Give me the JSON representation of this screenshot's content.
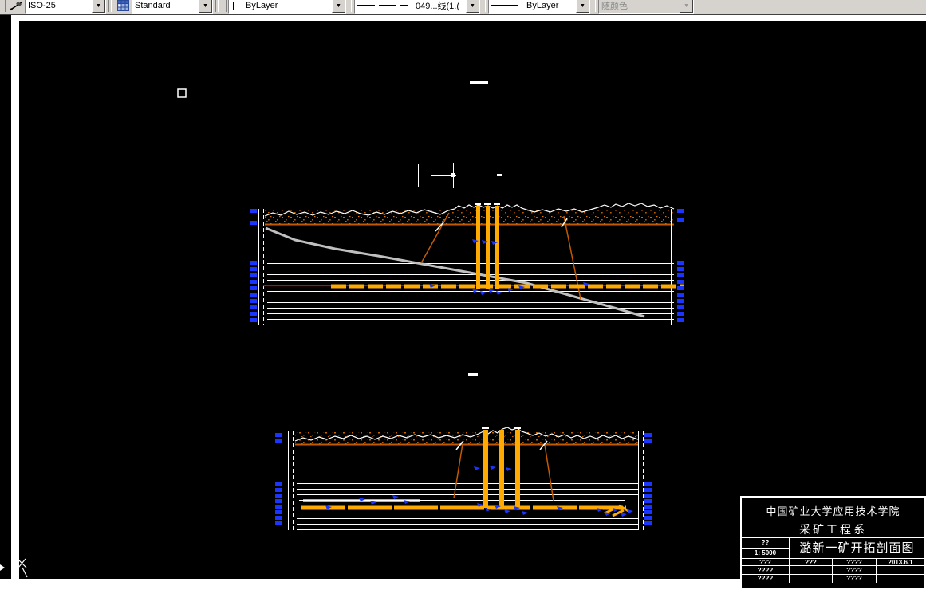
{
  "toolbar": {
    "dim_style_value": "ISO-25",
    "table_style_value": "Standard",
    "color_value": "ByLayer",
    "linetype_value": "049...线(1.(",
    "lineweight_value": "ByLayer",
    "plot_style_value": "随颜色"
  },
  "title_block": {
    "line1": "中国矿业大学应用技术学院",
    "line2": "采矿工程系",
    "scale_top": "??",
    "scale_bottom": "1: 5000",
    "drawing_title": "潞新一矿开拓剖面图",
    "row1": [
      "???",
      "???",
      "????",
      "2013.6.1"
    ],
    "row2": [
      "????",
      "",
      "????",
      ""
    ],
    "row3": [
      "????",
      "",
      "????",
      ""
    ]
  },
  "colors": {
    "toolbar_bg": "#d6d3ce",
    "canvas_bg": "#000000",
    "marker_blue": "#1a35ff",
    "shaft_yellow": "#ffaa00",
    "surface_orange": "#c35a00",
    "seam_red": "#d40000",
    "incline_gray": "#c0c0c0",
    "line_white": "#ffffff"
  }
}
